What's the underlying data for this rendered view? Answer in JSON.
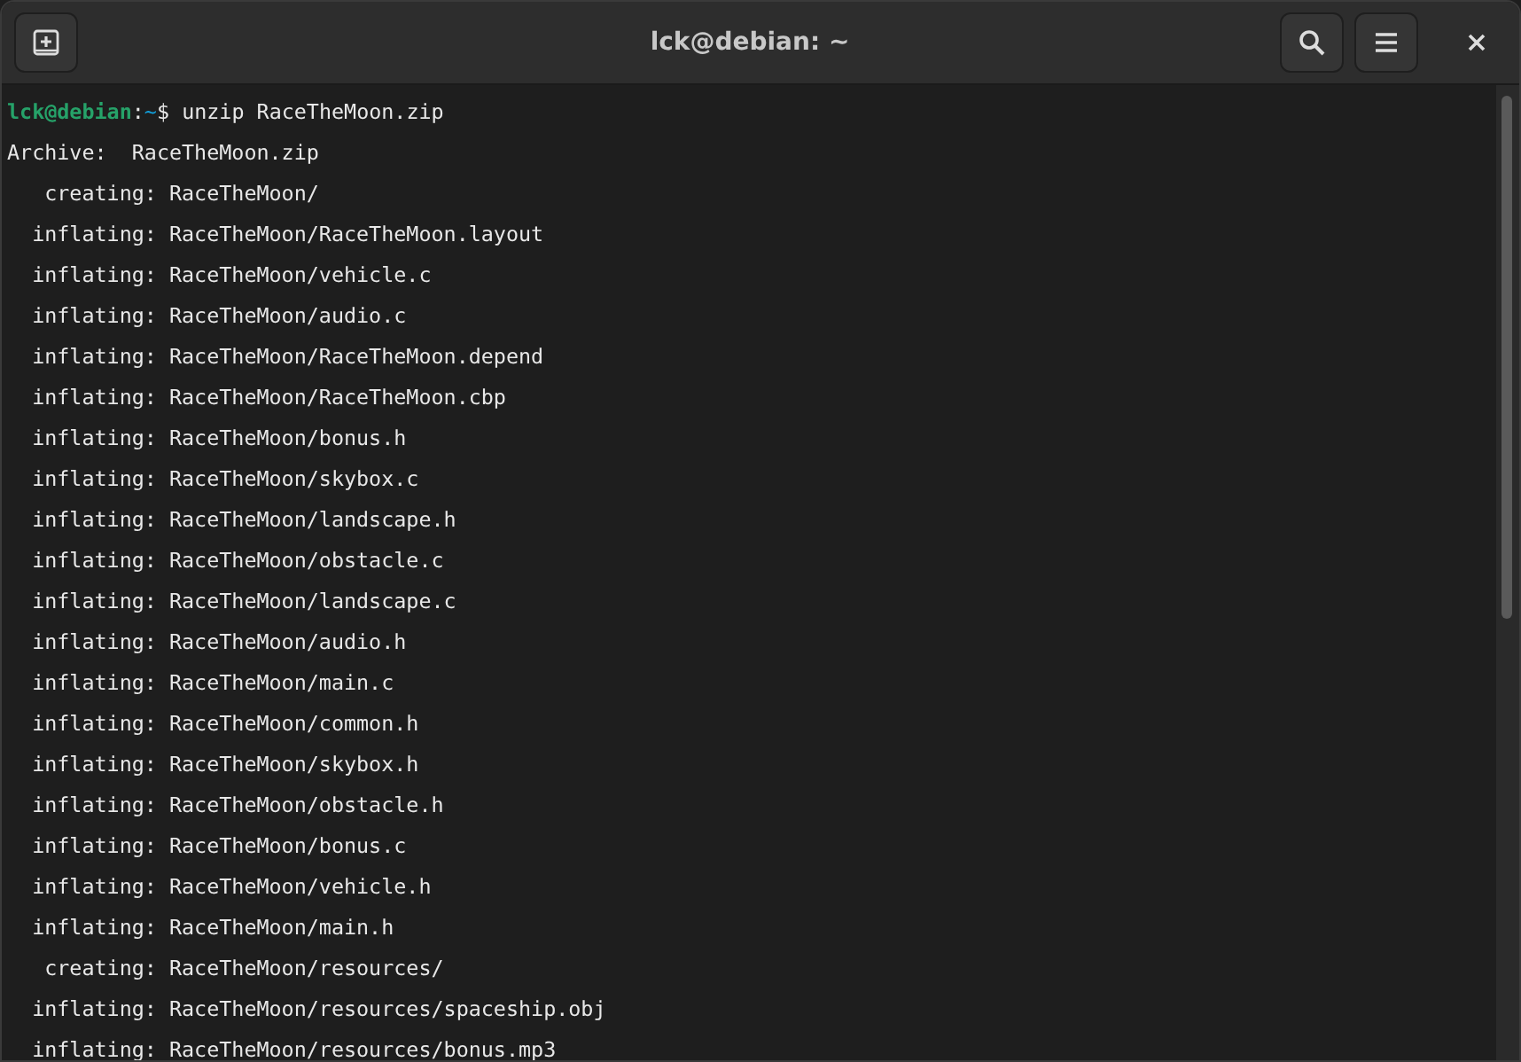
{
  "window": {
    "title": "lck@debian: ~"
  },
  "prompt": {
    "user_host": "lck@debian",
    "separator": ":",
    "path": "~",
    "symbol": "$",
    "command": "unzip RaceTheMoon.zip"
  },
  "output": [
    "Archive:  RaceTheMoon.zip",
    "   creating: RaceTheMoon/",
    "  inflating: RaceTheMoon/RaceTheMoon.layout",
    "  inflating: RaceTheMoon/vehicle.c",
    "  inflating: RaceTheMoon/audio.c",
    "  inflating: RaceTheMoon/RaceTheMoon.depend",
    "  inflating: RaceTheMoon/RaceTheMoon.cbp",
    "  inflating: RaceTheMoon/bonus.h",
    "  inflating: RaceTheMoon/skybox.c",
    "  inflating: RaceTheMoon/landscape.h",
    "  inflating: RaceTheMoon/obstacle.c",
    "  inflating: RaceTheMoon/landscape.c",
    "  inflating: RaceTheMoon/audio.h",
    "  inflating: RaceTheMoon/main.c",
    "  inflating: RaceTheMoon/common.h",
    "  inflating: RaceTheMoon/skybox.h",
    "  inflating: RaceTheMoon/obstacle.h",
    "  inflating: RaceTheMoon/bonus.c",
    "  inflating: RaceTheMoon/vehicle.h",
    "  inflating: RaceTheMoon/main.h",
    "   creating: RaceTheMoon/resources/",
    "  inflating: RaceTheMoon/resources/spaceship.obj",
    "  inflating: RaceTheMoon/resources/bonus.mp3"
  ]
}
